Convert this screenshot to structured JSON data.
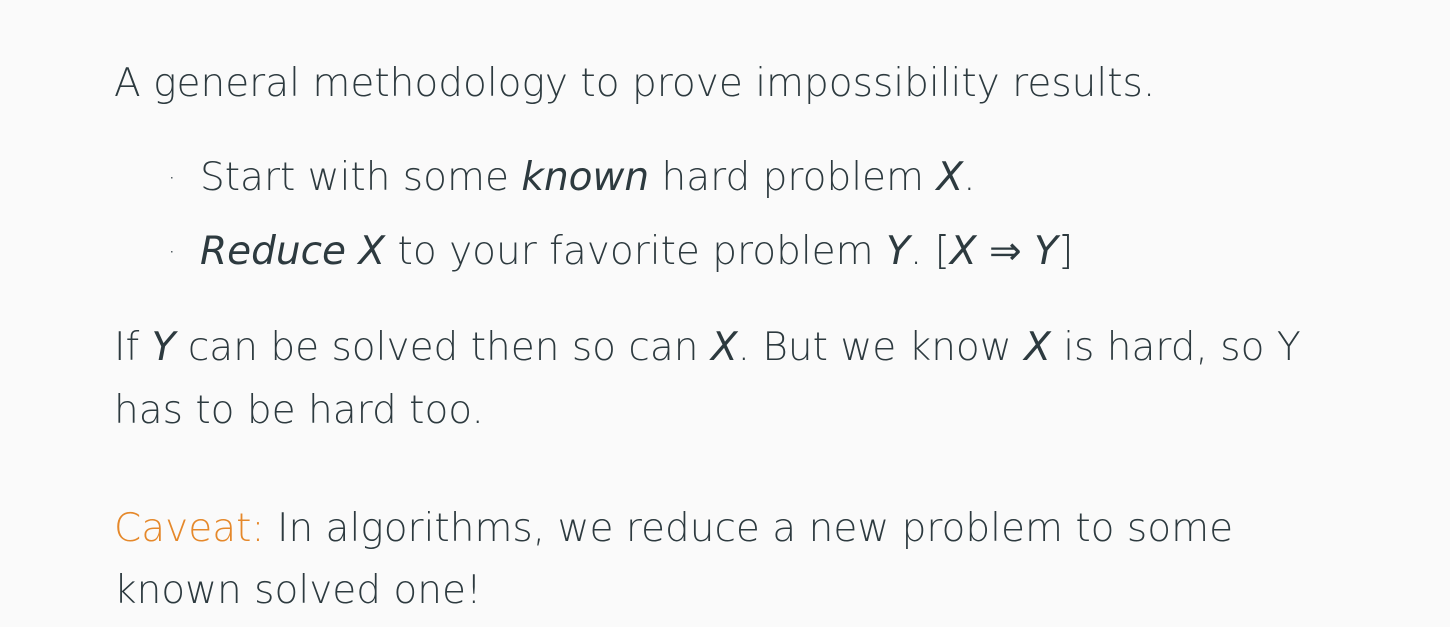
{
  "intro": "A general methodology to prove impossibility results.",
  "bullets": {
    "b1": {
      "dot": "·",
      "pre": "Start with some ",
      "known": "known",
      "mid": " hard problem ",
      "x": "X",
      "end": "."
    },
    "b2": {
      "dot": "·",
      "reduce": "Reduce",
      "sp1": " ",
      "x": "X",
      "mid": " to your favorite problem ",
      "y": "Y",
      "br_open": ". [",
      "x2": "X",
      "arrow": " ⇒ ",
      "y2": "Y",
      "br_close": "]"
    }
  },
  "conclusion": {
    "p1": "If ",
    "y": "Y",
    "p2": " can be solved then so can ",
    "x": "X",
    "p3": ". But we know ",
    "x2": "X",
    "p4": " is hard, so Y",
    "line2": "has to be hard too."
  },
  "caveat": {
    "label": "Caveat:",
    "text": " In algorithms, we reduce a new problem to some",
    "line2": "known solved one!"
  },
  "colors": {
    "text": "#2d3a3f",
    "accent": "#e5882a",
    "background": "#fafafa"
  }
}
